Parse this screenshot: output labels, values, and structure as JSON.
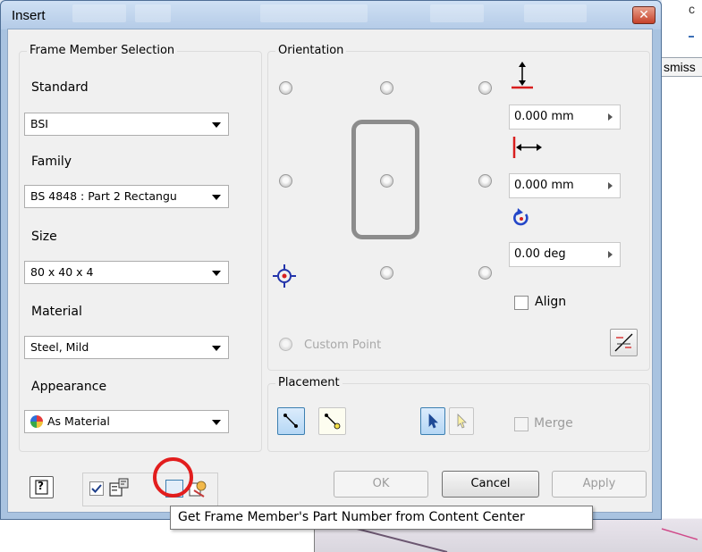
{
  "window": {
    "title": "Insert",
    "close_glyph": "✕"
  },
  "background": {
    "right_label": "smiss",
    "right_char": "c"
  },
  "selection": {
    "group_title": "Frame Member Selection",
    "standard": {
      "label": "Standard",
      "value": "BSI"
    },
    "family": {
      "label": "Family",
      "value": "BS 4848 : Part 2 Rectangu"
    },
    "size": {
      "label": "Size",
      "value": "80 x 40 x 4"
    },
    "material": {
      "label": "Material",
      "value": "Steel, Mild"
    },
    "appearance": {
      "label": "Appearance",
      "value": "As Material",
      "icon": "color-wheel-icon"
    }
  },
  "orientation": {
    "group_title": "Orientation",
    "offset_vertical": {
      "value": "0.000 mm",
      "icon": "vertical-offset-icon"
    },
    "offset_horizontal": {
      "value": "0.000 mm",
      "icon": "horizontal-offset-icon"
    },
    "rotation": {
      "value": "0.00 deg",
      "icon": "rotate-icon"
    },
    "align_label": "Align",
    "custom_point_label": "Custom Point",
    "selected_point": "middle-left"
  },
  "placement": {
    "group_title": "Placement",
    "merge_label": "Merge"
  },
  "buttons": {
    "ok": "OK",
    "cancel": "Cancel",
    "apply": "Apply",
    "help": "?"
  },
  "tooltip": "Get Frame Member's Part Number from Content Center",
  "colors": {
    "accent_red": "#e21d1d",
    "title_bar": "#b4cbe7",
    "active_button": "#b5d7f5"
  }
}
